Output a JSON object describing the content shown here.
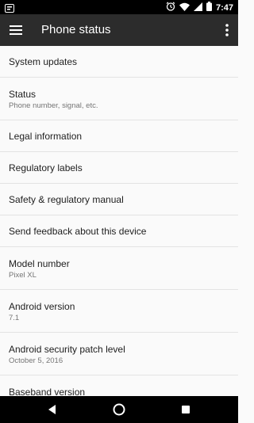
{
  "status_bar": {
    "time": "7:47",
    "icons": [
      "notification-icon",
      "alarm-icon",
      "wifi-icon",
      "signal-icon",
      "battery-icon"
    ]
  },
  "toolbar": {
    "title": "Phone status",
    "menu_icon": "hamburger-icon",
    "overflow_icon": "more-vert-icon"
  },
  "items": [
    {
      "title": "System updates"
    },
    {
      "title": "Status",
      "summary": "Phone number, signal, etc."
    },
    {
      "title": "Legal information"
    },
    {
      "title": "Regulatory labels"
    },
    {
      "title": "Safety & regulatory manual"
    },
    {
      "title": "Send feedback about this device"
    },
    {
      "title": "Model number",
      "summary": "Pixel XL"
    },
    {
      "title": "Android version",
      "summary": "7.1"
    },
    {
      "title": "Android security patch level",
      "summary": "October 5, 2016"
    },
    {
      "title": "Baseband version"
    }
  ],
  "nav_bar": {
    "icons": [
      "back-icon",
      "home-icon",
      "recents-icon"
    ]
  },
  "colors": {
    "toolbar": "#2c2c2c",
    "background": "#fafafa",
    "primary_text": "#212121",
    "secondary_text": "#757575",
    "divider": "#e3e3e3"
  }
}
